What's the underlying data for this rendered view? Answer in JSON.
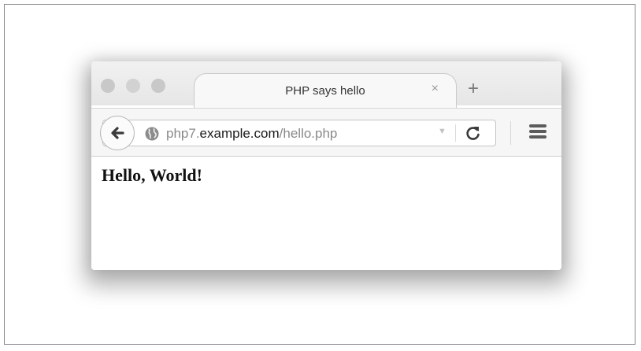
{
  "browser": {
    "tab": {
      "title": "PHP says hello",
      "close_glyph": "×"
    },
    "new_tab_glyph": "+",
    "url": {
      "prefix": "php7.",
      "host": "example.com",
      "path": "/hello.php"
    },
    "icons": {
      "back": "back-arrow-icon",
      "site": "globe-icon",
      "dropmarker": "dropmarker-icon",
      "reload": "reload-icon",
      "menu": "hamburger-menu-icon"
    }
  },
  "page": {
    "heading": "Hello, World!"
  }
}
